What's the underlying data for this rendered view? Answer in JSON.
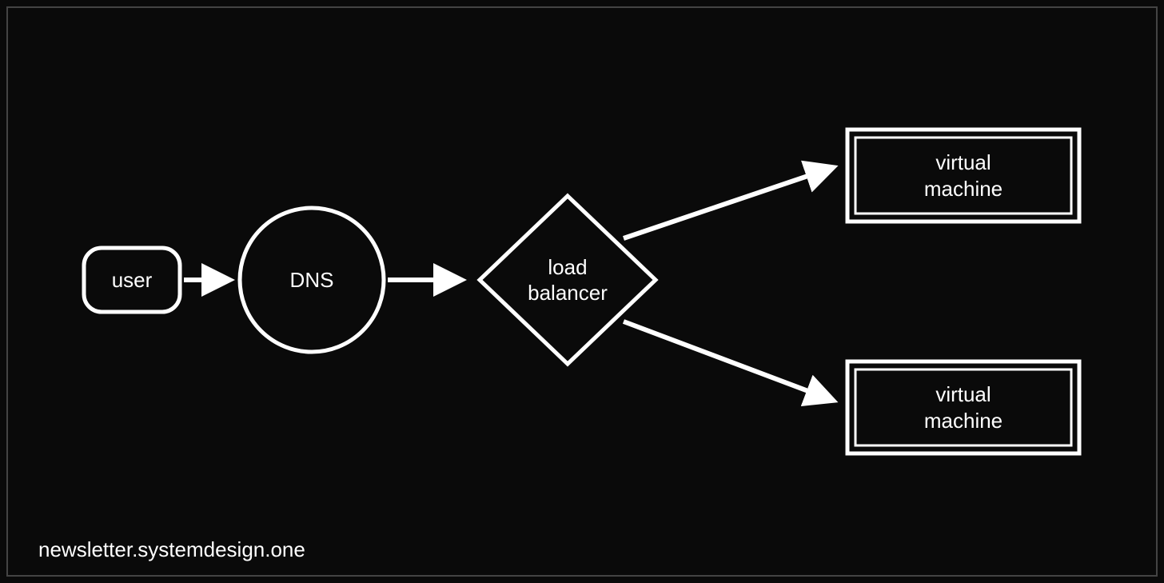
{
  "nodes": {
    "user": {
      "label": "user"
    },
    "dns": {
      "label": "DNS"
    },
    "loadBalancer": {
      "label": "load\nbalancer"
    },
    "vmTop": {
      "label": "virtual\nmachine"
    },
    "vmBottom": {
      "label": "virtual\nmachine"
    }
  },
  "edges": [
    {
      "from": "user",
      "to": "dns"
    },
    {
      "from": "dns",
      "to": "loadBalancer"
    },
    {
      "from": "loadBalancer",
      "to": "vmTop"
    },
    {
      "from": "loadBalancer",
      "to": "vmBottom"
    }
  ],
  "caption": "newsletter.systemdesign.one",
  "style": {
    "stroke": "#ffffff",
    "strokeWidth": 5,
    "background": "#0a0a0a"
  }
}
